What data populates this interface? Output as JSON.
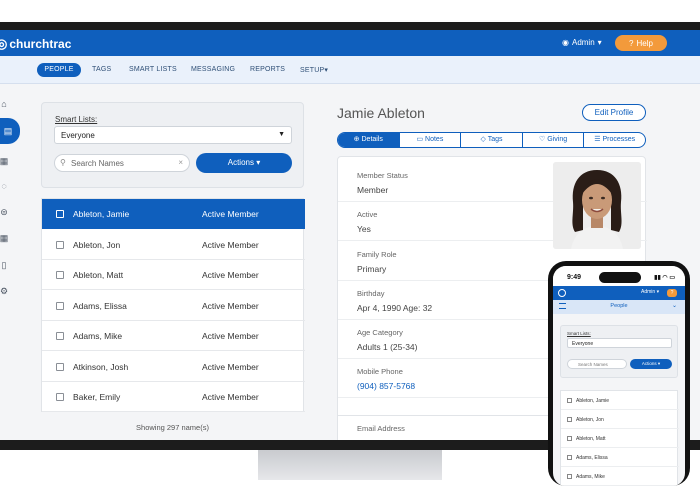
{
  "app": {
    "logo": "churchtrac",
    "admin_label": "Admin",
    "help_label": "Help"
  },
  "nav": {
    "items": [
      "PEOPLE",
      "TAGS",
      "SMART LISTS",
      "MESSAGING",
      "REPORTS",
      "SETUP"
    ]
  },
  "filters": {
    "smart_lists_label": "Smart Lists:",
    "smart_list_value": "Everyone",
    "search_placeholder": "Search Names",
    "actions_label": "Actions"
  },
  "people": [
    {
      "name": "Ableton, Jamie",
      "status": "Active Member",
      "selected": true
    },
    {
      "name": "Ableton, Jon",
      "status": "Active Member"
    },
    {
      "name": "Ableton, Matt",
      "status": "Active Member"
    },
    {
      "name": "Adams, Elissa",
      "status": "Active Member"
    },
    {
      "name": "Adams, Mike",
      "status": "Active Member"
    },
    {
      "name": "Atkinson, Josh",
      "status": "Active Member"
    },
    {
      "name": "Baker, Emily",
      "status": "Active Member"
    }
  ],
  "showing_text": "Showing 297 name(s)",
  "detail": {
    "name": "Jamie Ableton",
    "edit_label": "Edit Profile",
    "tabs": [
      "Details",
      "Notes",
      "Tags",
      "Giving",
      "Processes"
    ],
    "fields": [
      {
        "label": "Member Status",
        "value": "Member"
      },
      {
        "label": "Active",
        "value": "Yes"
      },
      {
        "label": "Family Role",
        "value": "Primary"
      },
      {
        "label": "Birthday",
        "value": "Apr 4, 1990 Age: 32"
      },
      {
        "label": "Age Category",
        "value": "Adults 1 (25-34)"
      },
      {
        "label": "Mobile Phone",
        "value": "(904) 857-5768"
      }
    ],
    "email_label": "Email Address"
  },
  "phone": {
    "time": "9:49",
    "admin_label": "Admin",
    "page_title": "People",
    "smart_lists_label": "Smart Lists:",
    "smart_list_value": "Everyone",
    "search_placeholder": "Search Names",
    "actions_label": "Actions",
    "people": [
      "Ableton, Jamie",
      "Ableton, Jon",
      "Ableton, Matt",
      "Adams, Elissa",
      "Adams, Mike"
    ]
  },
  "colors": {
    "brand": "#0f5fbd",
    "help": "#f39a3b"
  }
}
